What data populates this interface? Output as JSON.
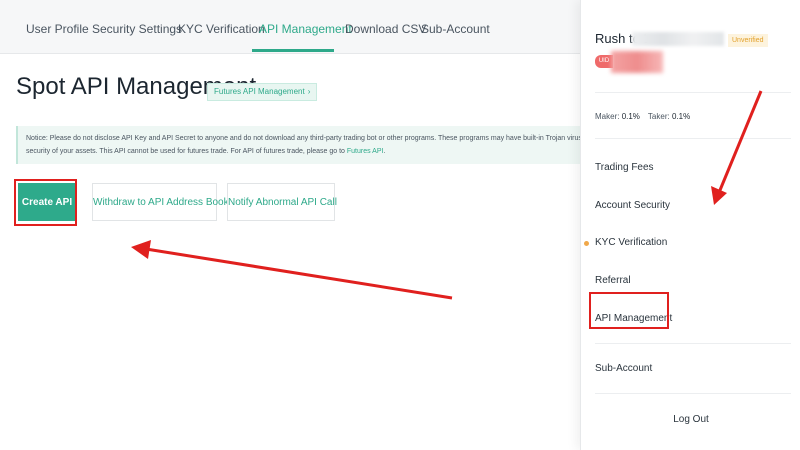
{
  "tabs": [
    {
      "label": "User Profile"
    },
    {
      "label": "Security Settings"
    },
    {
      "label": "KYC Verification"
    },
    {
      "label": "API Management"
    },
    {
      "label": "Download CSV"
    },
    {
      "label": "Sub-Account"
    }
  ],
  "header": {
    "title": "Spot API Management",
    "futures_link": "Futures API Management",
    "futures_chevron": "›"
  },
  "notice": {
    "line1": "Notice: Please do not disclose API Key and API Secret to anyone and do not download any third-party trading bot or other programs. These programs may have built-in Trojan viruses and will",
    "line2": "security of your assets. This API cannot be used for futures trade. For API of futures trade, please go to",
    "link": "Futures API",
    "link_suffix": "."
  },
  "actions": {
    "create": "Create API",
    "withdraw": "Withdraw to API Address Book",
    "notify": "Notify Abnormal API Call"
  },
  "panel": {
    "user_name": "Rush to t",
    "verify_badge": "Unverified",
    "uid_label": "UID",
    "maker_label": "Maker:",
    "maker_value": "0.1%",
    "taker_label": "Taker:",
    "taker_value": "0.1%",
    "menu": [
      {
        "label": "Trading Fees"
      },
      {
        "label": "Account Security"
      },
      {
        "label": "KYC Verification"
      },
      {
        "label": "Referral"
      },
      {
        "label": "API Management"
      },
      {
        "label": "Sub-Account"
      }
    ],
    "logout": "Log Out"
  },
  "colors": {
    "accent": "#2eaa8b",
    "annotation": "#e0201e",
    "badge": "#e2a12b",
    "dot": "#f0a84a"
  }
}
